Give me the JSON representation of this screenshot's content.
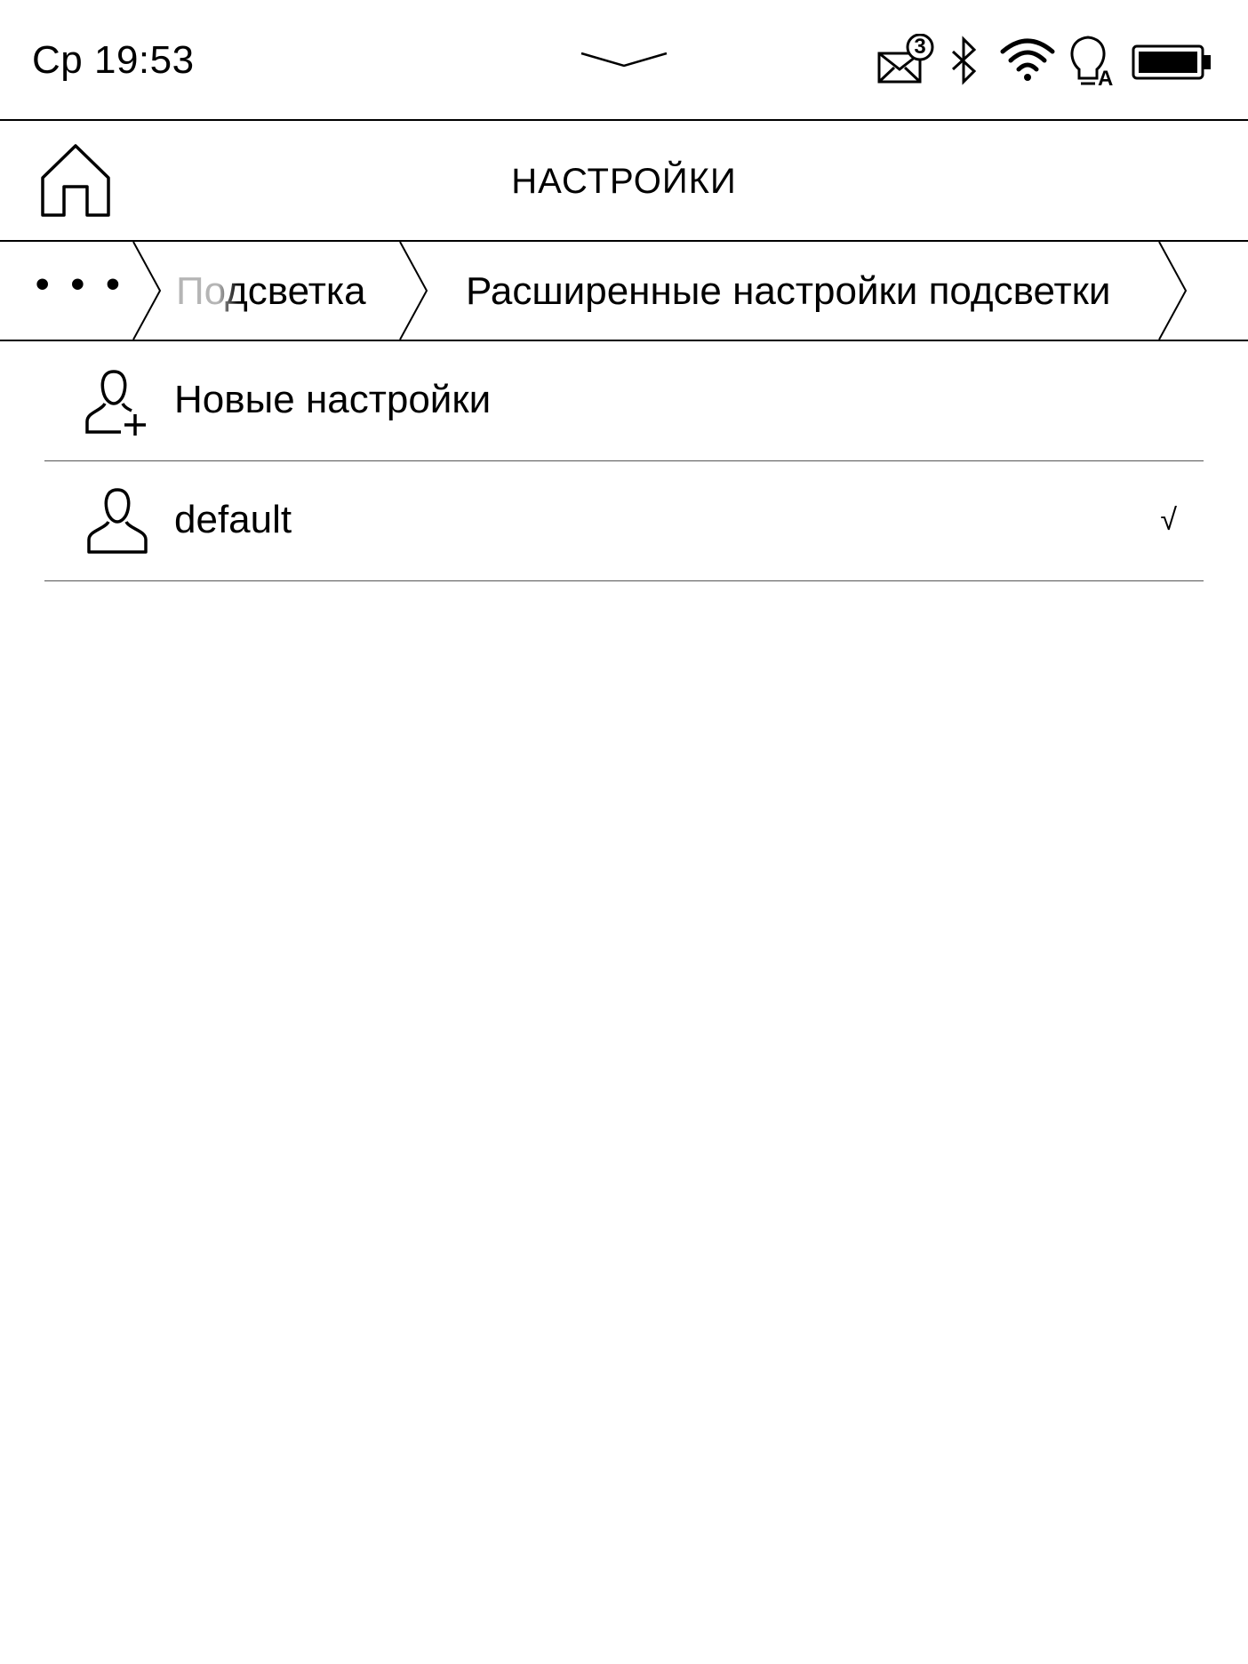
{
  "status_bar": {
    "clock": "Ср 19:53",
    "notification_count": "3",
    "icons": [
      "pull-down-chevron-icon",
      "mail-icon",
      "bluetooth-icon",
      "wifi-icon",
      "auto-light-bulb-icon",
      "battery-icon"
    ],
    "light_mode_letter": "A",
    "battery_level": 1.0
  },
  "header": {
    "title": "НАСТРОЙКИ",
    "home_icon": "home-icon"
  },
  "breadcrumb": {
    "more": "• • •",
    "items": [
      "Подсветка",
      "Расширенные настройки подсветки"
    ]
  },
  "profiles": {
    "items": [
      {
        "label": "Новые настройки",
        "icon": "add-user-icon",
        "checked": false,
        "check": ""
      },
      {
        "label": "default",
        "icon": "user-icon",
        "checked": true,
        "check": "√"
      }
    ]
  }
}
